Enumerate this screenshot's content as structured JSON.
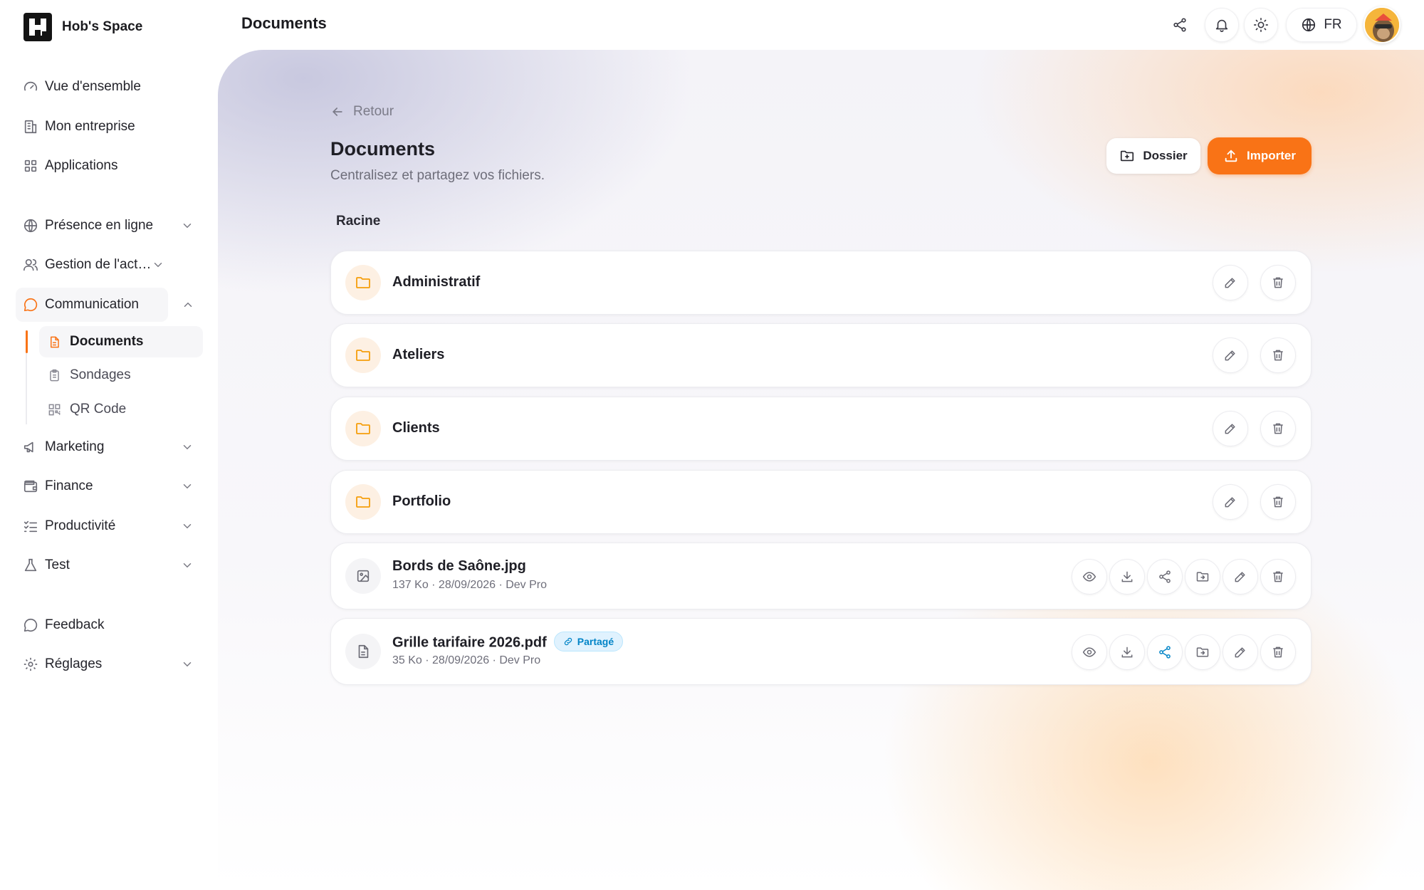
{
  "brand": {
    "name": "Hob's Space"
  },
  "sidebar": {
    "items": [
      {
        "label": "Vue d'ensemble",
        "icon": "gauge-icon"
      },
      {
        "label": "Mon entreprise",
        "icon": "building-icon"
      },
      {
        "label": "Applications",
        "icon": "grid-icon"
      },
      {
        "label": "Présence en ligne",
        "icon": "globe-icon"
      },
      {
        "label": "Gestion de l'activité",
        "icon": "users-icon"
      },
      {
        "label": "Communication",
        "icon": "chat-icon"
      },
      {
        "label": "Marketing",
        "icon": "megaphone-icon"
      },
      {
        "label": "Finance",
        "icon": "wallet-icon"
      },
      {
        "label": "Productivité",
        "icon": "checklist-icon"
      },
      {
        "label": "Test",
        "icon": "flask-icon"
      },
      {
        "label": "Feedback",
        "icon": "chat-icon"
      },
      {
        "label": "Réglages",
        "icon": "gear-icon"
      }
    ],
    "subitems": [
      {
        "label": "Documents",
        "icon": "document-icon",
        "active": true
      },
      {
        "label": "Sondages",
        "icon": "clipboard-icon"
      },
      {
        "label": "QR Code",
        "icon": "qr-code-icon"
      }
    ]
  },
  "topbar": {
    "title": "Documents",
    "language": "FR",
    "icons": [
      "share-icon",
      "bell-icon",
      "sun-icon",
      "globe-icon"
    ]
  },
  "main": {
    "back_label": "Retour",
    "title": "Documents",
    "subtitle": "Centralisez et partagez vos fichiers.",
    "folder_button": "Dossier",
    "import_button": "Importer",
    "breadcrumb": "Racine",
    "folders": [
      {
        "name": "Administratif"
      },
      {
        "name": "Ateliers"
      },
      {
        "name": "Clients"
      },
      {
        "name": "Portfolio"
      }
    ],
    "files": [
      {
        "name": "Bords de Saône.jpg",
        "meta": "137 Ko · 28/09/2026 · Dev Pro",
        "type": "image"
      },
      {
        "name": "Grille tarifaire 2026.pdf",
        "meta": "35 Ko · 28/09/2026 · Dev Pro",
        "type": "document",
        "badge": "Partagé"
      }
    ]
  },
  "colors": {
    "accent": "#f97316",
    "shared": "#0284c7",
    "folder": "#f59e0b"
  }
}
